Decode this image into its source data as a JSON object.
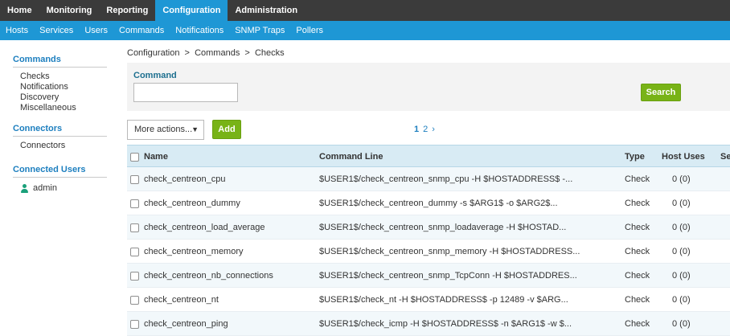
{
  "topnav": [
    "Home",
    "Monitoring",
    "Reporting",
    "Configuration",
    "Administration"
  ],
  "subnav": [
    "Hosts",
    "Services",
    "Users",
    "Commands",
    "Notifications",
    "SNMP Traps",
    "Pollers"
  ],
  "sidebar": {
    "commands_title": "Commands",
    "commands_items": [
      "Checks",
      "Notifications",
      "Discovery",
      "Miscellaneous"
    ],
    "connectors_title": "Connectors",
    "connectors_items": [
      "Connectors"
    ],
    "users_title": "Connected Users",
    "user": "admin"
  },
  "breadcrumb": "Configuration  >  Commands  >  Checks",
  "filter": {
    "label": "Command",
    "value": "",
    "search_label": "Search"
  },
  "actions": {
    "more_label": "More actions...",
    "add_label": "Add"
  },
  "pager": {
    "current": "1",
    "next_page": "2",
    "next_icon": "›"
  },
  "table": {
    "headers": {
      "name": "Name",
      "command_line": "Command Line",
      "type": "Type",
      "host_uses": "Host Uses",
      "se": "Se"
    },
    "rows": [
      {
        "name": "check_centreon_cpu",
        "cmd": "$USER1$/check_centreon_snmp_cpu -H $HOSTADDRESS$ -...",
        "type": "Check",
        "host_uses": "0 (0)"
      },
      {
        "name": "check_centreon_dummy",
        "cmd": "$USER1$/check_centreon_dummy -s $ARG1$ -o $ARG2$...",
        "type": "Check",
        "host_uses": "0 (0)"
      },
      {
        "name": "check_centreon_load_average",
        "cmd": "$USER1$/check_centreon_snmp_loadaverage -H $HOSTAD...",
        "type": "Check",
        "host_uses": "0 (0)"
      },
      {
        "name": "check_centreon_memory",
        "cmd": "$USER1$/check_centreon_snmp_memory -H $HOSTADDRESS...",
        "type": "Check",
        "host_uses": "0 (0)"
      },
      {
        "name": "check_centreon_nb_connections",
        "cmd": "$USER1$/check_centreon_snmp_TcpConn -H $HOSTADDRES...",
        "type": "Check",
        "host_uses": "0 (0)"
      },
      {
        "name": "check_centreon_nt",
        "cmd": "$USER1$/check_nt -H $HOSTADDRESS$ -p 12489 -v $ARG...",
        "type": "Check",
        "host_uses": "0 (0)"
      },
      {
        "name": "check_centreon_ping",
        "cmd": "$USER1$/check_icmp -H $HOSTADDRESS$ -n $ARG1$ -w $...",
        "type": "Check",
        "host_uses": "0 (0)"
      }
    ]
  }
}
